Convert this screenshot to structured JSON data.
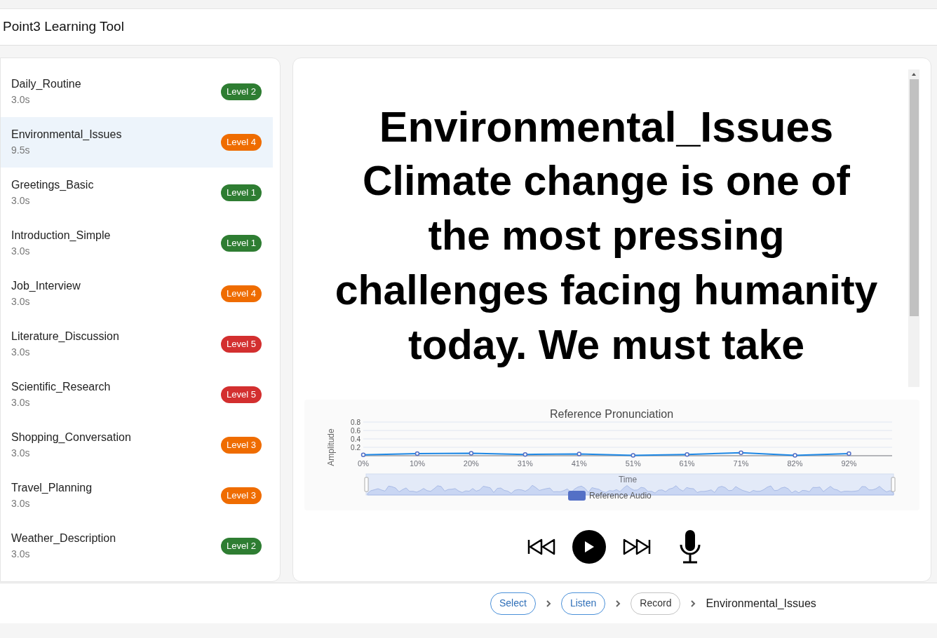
{
  "app": {
    "title": "Point3 Learning Tool"
  },
  "lessons": [
    {
      "name": "Daily_Routine",
      "duration": "3.0s",
      "level": "Level 2",
      "color": "#2e7d32",
      "selected": false
    },
    {
      "name": "Environmental_Issues",
      "duration": "9.5s",
      "level": "Level 4",
      "color": "#ef6c00",
      "selected": true
    },
    {
      "name": "Greetings_Basic",
      "duration": "3.0s",
      "level": "Level 1",
      "color": "#2e7d32",
      "selected": false
    },
    {
      "name": "Introduction_Simple",
      "duration": "3.0s",
      "level": "Level 1",
      "color": "#2e7d32",
      "selected": false
    },
    {
      "name": "Job_Interview",
      "duration": "3.0s",
      "level": "Level 4",
      "color": "#ef6c00",
      "selected": false
    },
    {
      "name": "Literature_Discussion",
      "duration": "3.0s",
      "level": "Level 5",
      "color": "#d32f2f",
      "selected": false
    },
    {
      "name": "Scientific_Research",
      "duration": "3.0s",
      "level": "Level 5",
      "color": "#d32f2f",
      "selected": false
    },
    {
      "name": "Shopping_Conversation",
      "duration": "3.0s",
      "level": "Level 3",
      "color": "#ef6c00",
      "selected": false
    },
    {
      "name": "Travel_Planning",
      "duration": "3.0s",
      "level": "Level 3",
      "color": "#ef6c00",
      "selected": false
    },
    {
      "name": "Weather_Description",
      "duration": "3.0s",
      "level": "Level 2",
      "color": "#2e7d32",
      "selected": false
    }
  ],
  "lesson_view": {
    "title": "Environmental_Issues",
    "text": "Climate change is one of the most pressing challenges facing humanity today. We must take",
    "chart": {
      "chart_data": {
        "type": "line",
        "title": "Reference Pronunciation",
        "xlabel": "Time",
        "ylabel": "Amplitude",
        "categories": [
          "0%",
          "10%",
          "20%",
          "31%",
          "41%",
          "51%",
          "61%",
          "71%",
          "82%",
          "92%"
        ],
        "series": [
          {
            "name": "Reference Audio",
            "color": "#1e88e5",
            "values": [
              0.02,
              0.05,
              0.06,
              0.03,
              0.04,
              0.01,
              0.03,
              0.07,
              0.01,
              0.05
            ]
          }
        ],
        "ylim": [
          0,
          0.8
        ],
        "yticks": [
          0.2,
          0.4,
          0.6,
          0.8
        ],
        "grid": true,
        "marker": "circle"
      }
    }
  },
  "steps": [
    {
      "label": "Select",
      "completed": true
    },
    {
      "label": "Listen",
      "completed": true
    },
    {
      "label": "Record",
      "completed": false
    }
  ],
  "current_lesson": "Environmental_Issues"
}
